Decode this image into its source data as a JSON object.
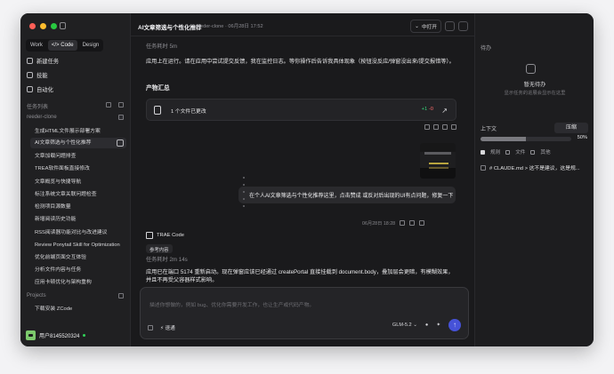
{
  "window": {
    "colors": {
      "red": "#ff5f57",
      "yellow": "#ffbd2e",
      "green": "#28c840"
    }
  },
  "sidebar": {
    "mode_tabs": [
      "Work",
      "</> Code",
      "Design"
    ],
    "nav": [
      {
        "label": "新建任务",
        "icon": "new-task-icon"
      },
      {
        "label": "技能",
        "icon": "skill-icon"
      },
      {
        "label": "自动化",
        "icon": "automation-icon"
      }
    ],
    "task_list_label": "任务列表",
    "project_label": "reeder-clone",
    "tasks": [
      "生成HTML文件展示部署方案",
      "AI文章筛选与个性化推荐",
      "文章加载问题排查",
      "TREA软件面板直接修改",
      "文章概览与快捷导航",
      "标注系统文章关联问题检查",
      "检测项目源数量",
      "新增阅读历史功能",
      "RSS阅读器功能对比与改进建议",
      "Review Ponytail Skill for Optimization",
      "优化前端页面交互体验",
      "分析文件内容与任务",
      "应用卡顿优化与架构重构"
    ],
    "projects_label": "Projects",
    "download_task": "下载安装 ZCode",
    "user": "用户8145520324"
  },
  "main": {
    "title": "AI文章筛选与个性化推荐",
    "breadcrumb": "reeder-clone · 06月28日 17:52",
    "ide_label": "中打开",
    "task_elapsed_top": "任务耗时 5m",
    "status_message": "应用上在运行。请在应用中尝试提交反馈，我在监控日志。等你操作后告诉我具体现象（按钮没反应/弹窗没出来/提交报错等）。",
    "artifact_title": "产物汇总",
    "file_summary": "1 个文件已更改",
    "added": "+1",
    "removed": "-0",
    "user_message": "在个人AI文章筛选与个性化推荐这里，点击赞成 或反对后出现的UI有点问题，修复一下",
    "message_time": "06月28日 18:28",
    "agent_name": "TRAE Code",
    "reference": "参考内容",
    "task_elapsed_bottom": "任务耗时 2m 14s",
    "final_message": "应用已在端口 5174 重新启动。现在弹窗应该已经通过 createPortal 直接挂载到 document.body，叠加层会更暗，有模糊效果，并且不再受父容器样式影响。",
    "composer_placeholder": "描述你想做的，例如 bug、优化你需要开发工作，也让生产或代码产物。",
    "mode": "速通",
    "model": "GLM-5.2"
  },
  "right_panel": {
    "pending": "待办",
    "empty_title": "暂无待办",
    "empty_desc": "显示任务的进展会显示在这里",
    "context": "上下文",
    "compress": "压缩",
    "progress_percent": "50%",
    "progress_value": 0.5,
    "tabs": [
      "规则",
      "文件",
      "其他"
    ],
    "rule_text": "# CLAUDE.md > 这不是建议，这是规..."
  }
}
